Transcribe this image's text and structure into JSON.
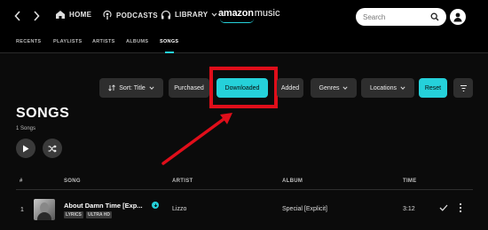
{
  "header": {
    "nav": [
      {
        "label": "HOME",
        "icon": "home-icon"
      },
      {
        "label": "PODCASTS",
        "icon": "podcast-icon"
      },
      {
        "label": "LIBRARY",
        "icon": "headphones-icon"
      }
    ],
    "logo_brand": "amazon",
    "logo_product": "music",
    "search_placeholder": "Search"
  },
  "subnav": {
    "tabs": [
      "RECENTS",
      "PLAYLISTS",
      "ARTISTS",
      "ALBUMS",
      "SONGS"
    ],
    "active": "SONGS"
  },
  "filters": {
    "sort": "Sort: Title",
    "purchased": "Purchased",
    "downloaded": "Downloaded",
    "added": "Added",
    "genres": "Genres",
    "locations": "Locations",
    "reset": "Reset"
  },
  "page": {
    "title": "SONGS",
    "count": "1 Songs"
  },
  "table": {
    "headers": {
      "song": "SONG",
      "artist": "ARTIST",
      "album": "ALBUM",
      "time": "TIME"
    },
    "rows": [
      {
        "index": "1",
        "title": "About Damn Time [Exp...",
        "badges": [
          "LYRICS",
          "ULTRA HD"
        ],
        "artist": "Lizzo",
        "album": "Special [Explicit]",
        "time": "3:12"
      }
    ]
  },
  "colors": {
    "accent": "#25d1da",
    "highlight": "#e00e1a"
  }
}
